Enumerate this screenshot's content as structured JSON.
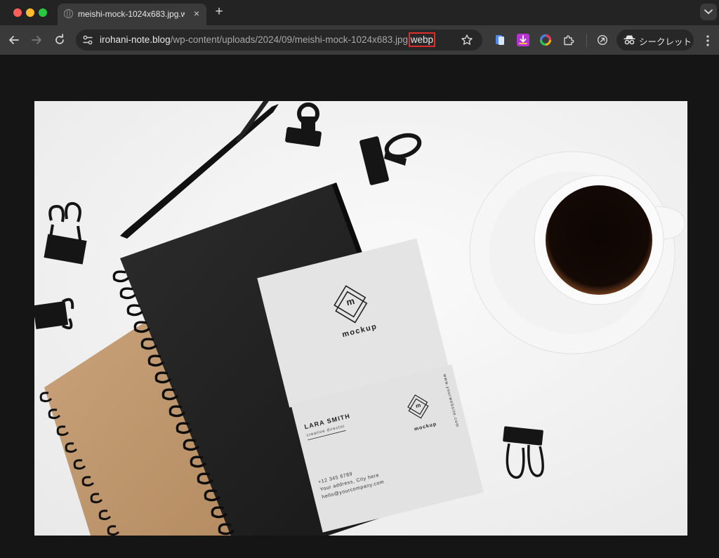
{
  "browser": {
    "tab_title": "meishi-mock-1024x683.jpg.webp",
    "tab_close": "×",
    "new_tab": "+",
    "url_domain": "irohani-note.blog",
    "url_path": "/wp-content/uploads/2024/09/meishi-mock-1024x683.jpg.",
    "url_highlight": "webp",
    "incognito_label": "シークレット",
    "highlight_color": "#e02b2b"
  },
  "image": {
    "logo_card": {
      "brand": "mockup",
      "monogram": "m"
    },
    "business_card": {
      "name": "LARA SMITH",
      "role": "creative director",
      "phone": "+12 345 6789",
      "address": "Your address, City here",
      "email": "hello@yourcompany.com",
      "website": "www.yourwebsite.com",
      "brand": "mockup",
      "monogram": "m"
    }
  }
}
